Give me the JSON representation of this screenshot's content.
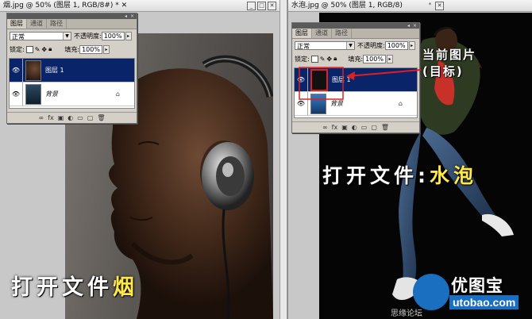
{
  "left": {
    "doc_title": "烟.jpg @ 50% (图层 1, RGB/8#) * ✕",
    "panel": {
      "tabs": [
        "图层",
        "通道",
        "路径"
      ],
      "blend_mode": "正常",
      "opacity_label": "不透明度:",
      "opacity_value": "100%",
      "lock_label": "锁定:",
      "fill_label": "填充:",
      "fill_value": "100%",
      "layers": [
        "图层 1",
        "背景"
      ],
      "selected_layer_index": 0
    },
    "caption_prefix": "打开文件",
    "caption_highlight": "烟"
  },
  "right": {
    "doc_title": "水泡.jpg @ 50% (图层 1, RGB/8)",
    "panel": {
      "tabs": [
        "图层",
        "通道",
        "路径"
      ],
      "blend_mode": "正常",
      "opacity_label": "不透明度:",
      "opacity_value": "100%",
      "lock_label": "锁定:",
      "fill_label": "填充:",
      "fill_value": "100%",
      "layers": [
        "图层 1",
        "背景"
      ],
      "selected_layer_index": 0
    },
    "annotation_line1": "当前图片",
    "annotation_line2": "(目标)",
    "caption_prefix": "打开文件:",
    "caption_highlight": "水泡",
    "watermark_brand": "优图宝",
    "watermark_url": "utobao.com",
    "watermark_partial": "思缘论坛"
  },
  "colors": {
    "selected_layer": "#0a246a",
    "annotation_arrow": "#e02020",
    "caption_highlight": "#ffe94a",
    "watermark_blue": "#1a6fc0"
  }
}
